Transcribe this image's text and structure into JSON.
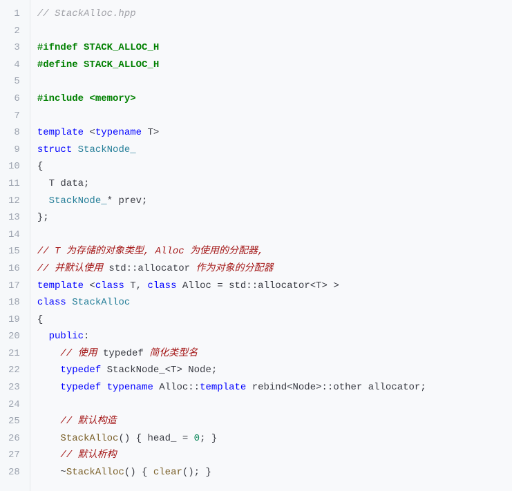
{
  "lines": [
    {
      "num": "1",
      "tokens": [
        {
          "t": "// StackAlloc.hpp",
          "cls": "cmt",
          "ind": 0
        }
      ]
    },
    {
      "num": "2",
      "tokens": []
    },
    {
      "num": "3",
      "tokens": [
        {
          "t": "#ifndef STACK_ALLOC_H",
          "cls": "pp",
          "ind": 0
        }
      ]
    },
    {
      "num": "4",
      "tokens": [
        {
          "t": "#define STACK_ALLOC_H",
          "cls": "pp",
          "ind": 0
        }
      ]
    },
    {
      "num": "5",
      "tokens": []
    },
    {
      "num": "6",
      "tokens": [
        {
          "t": "#include <memory>",
          "cls": "pp",
          "ind": 0
        }
      ]
    },
    {
      "num": "7",
      "tokens": []
    },
    {
      "num": "8",
      "tokens": [
        {
          "t": "template",
          "cls": "kw",
          "ind": 0
        },
        {
          "t": " <",
          "cls": "punc"
        },
        {
          "t": "typename",
          "cls": "kw"
        },
        {
          "t": " T>",
          "cls": "punc"
        }
      ]
    },
    {
      "num": "9",
      "tokens": [
        {
          "t": "struct",
          "cls": "kw",
          "ind": 0
        },
        {
          "t": " ",
          "cls": "punc"
        },
        {
          "t": "StackNode_",
          "cls": "type"
        }
      ]
    },
    {
      "num": "10",
      "tokens": [
        {
          "t": "{",
          "cls": "punc",
          "ind": 0
        }
      ]
    },
    {
      "num": "11",
      "tokens": [
        {
          "t": "T data;",
          "cls": "id",
          "ind": 2
        }
      ]
    },
    {
      "num": "12",
      "tokens": [
        {
          "t": "StackNode_",
          "cls": "type",
          "ind": 2
        },
        {
          "t": "* prev;",
          "cls": "id"
        }
      ]
    },
    {
      "num": "13",
      "tokens": [
        {
          "t": "};",
          "cls": "punc",
          "ind": 0
        }
      ]
    },
    {
      "num": "14",
      "tokens": []
    },
    {
      "num": "15",
      "cmt2": true,
      "tokens": [
        {
          "t": "// T 为存储的对象类型, Alloc 为使用的分配器,",
          "cls": "cmt2",
          "ind": 0
        }
      ]
    },
    {
      "num": "16",
      "cmt2": true,
      "tokens": [
        {
          "t": "// 并默认使用 ",
          "cls": "cmt2",
          "ind": 0
        },
        {
          "t": "std::allocator",
          "cls": "kwc"
        },
        {
          "t": " 作为对象的分配器",
          "cls": "cmt2"
        }
      ]
    },
    {
      "num": "17",
      "tokens": [
        {
          "t": "template",
          "cls": "kw",
          "ind": 0
        },
        {
          "t": " <",
          "cls": "punc"
        },
        {
          "t": "class",
          "cls": "kw"
        },
        {
          "t": " T, ",
          "cls": "punc"
        },
        {
          "t": "class",
          "cls": "kw"
        },
        {
          "t": " Alloc = std::allocator<T> >",
          "cls": "punc"
        }
      ]
    },
    {
      "num": "18",
      "tokens": [
        {
          "t": "class",
          "cls": "kw",
          "ind": 0
        },
        {
          "t": " ",
          "cls": "punc"
        },
        {
          "t": "StackAlloc",
          "cls": "type"
        }
      ]
    },
    {
      "num": "19",
      "tokens": [
        {
          "t": "{",
          "cls": "punc",
          "ind": 0
        }
      ]
    },
    {
      "num": "20",
      "tokens": [
        {
          "t": "public",
          "cls": "kw",
          "ind": 2
        },
        {
          "t": ":",
          "cls": "punc"
        }
      ]
    },
    {
      "num": "21",
      "cmt2": true,
      "tokens": [
        {
          "t": "// 使用 ",
          "cls": "cmt2",
          "ind": 4
        },
        {
          "t": "typedef",
          "cls": "kwc"
        },
        {
          "t": " 简化类型名",
          "cls": "cmt2"
        }
      ]
    },
    {
      "num": "22",
      "tokens": [
        {
          "t": "typedef",
          "cls": "kw",
          "ind": 4
        },
        {
          "t": " StackNode_<T> Node;",
          "cls": "id"
        }
      ]
    },
    {
      "num": "23",
      "tokens": [
        {
          "t": "typedef",
          "cls": "kw",
          "ind": 4
        },
        {
          "t": " ",
          "cls": "punc"
        },
        {
          "t": "typename",
          "cls": "kw"
        },
        {
          "t": " Alloc::",
          "cls": "id"
        },
        {
          "t": "template",
          "cls": "kw"
        },
        {
          "t": " rebind<Node>::other allocator;",
          "cls": "id"
        }
      ]
    },
    {
      "num": "24",
      "tokens": []
    },
    {
      "num": "25",
      "cmt2": true,
      "tokens": [
        {
          "t": "// 默认构造",
          "cls": "cmt2",
          "ind": 4
        }
      ]
    },
    {
      "num": "26",
      "tokens": [
        {
          "t": "StackAlloc",
          "cls": "fn",
          "ind": 4
        },
        {
          "t": "() { head_ = ",
          "cls": "id"
        },
        {
          "t": "0",
          "cls": "num"
        },
        {
          "t": "; }",
          "cls": "id"
        }
      ]
    },
    {
      "num": "27",
      "cmt2": true,
      "tokens": [
        {
          "t": "// 默认析构",
          "cls": "cmt2",
          "ind": 4
        }
      ]
    },
    {
      "num": "28",
      "tokens": [
        {
          "t": "~",
          "cls": "punc",
          "ind": 4
        },
        {
          "t": "StackAlloc",
          "cls": "fn"
        },
        {
          "t": "() { ",
          "cls": "id"
        },
        {
          "t": "clear",
          "cls": "fn"
        },
        {
          "t": "(); }",
          "cls": "id"
        }
      ]
    }
  ]
}
